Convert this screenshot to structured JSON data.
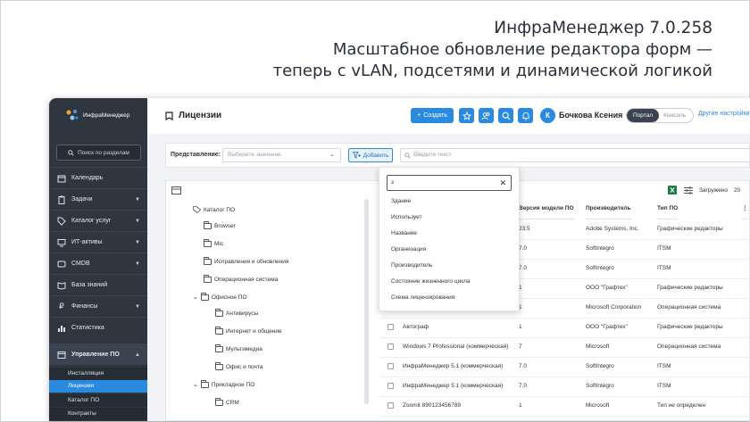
{
  "headline": {
    "line1": "ИнфраМенеджер 7.0.258",
    "line2": "Масштабное обновление редактора форм —",
    "line3": "теперь с vLAN, подсетями и динамической логикой"
  },
  "sidebar": {
    "logo_text": "ИнфраМенеджер",
    "search_placeholder": "Поиск по разделам",
    "items": [
      {
        "label": "Календарь",
        "icon": "calendar-icon"
      },
      {
        "label": "Задачи",
        "icon": "clipboard-icon"
      },
      {
        "label": "Каталог услуг",
        "icon": "tag-icon"
      },
      {
        "label": "ИТ-активы",
        "icon": "monitor-icon"
      },
      {
        "label": "CMDB",
        "icon": "database-icon"
      },
      {
        "label": "База знаний",
        "icon": "book-icon"
      },
      {
        "label": "Финансы",
        "icon": "ruble-icon"
      },
      {
        "label": "Статистика",
        "icon": "bar-chart-icon"
      },
      {
        "label": "Управление ПО",
        "icon": "window-icon"
      }
    ],
    "subitems": [
      "Инсталляции",
      "Лицензии",
      "Каталог ПО",
      "Контракты"
    ]
  },
  "topbar": {
    "title": "Лицензии",
    "create_label": "Создать",
    "avatar_letter": "К",
    "user_name": "Бочкова Ксения",
    "toggle_on": "Портал",
    "toggle_off": "Консоль",
    "other_settings": "Другие настройки"
  },
  "filter": {
    "label": "Представление:",
    "select_placeholder": "Выберите значение",
    "add_label": "Добавить",
    "text_placeholder": "Введите текст"
  },
  "panel": {
    "loaded_label": "Загружено",
    "loaded_count": "20"
  },
  "tree": [
    "Каталог ПО",
    "Browser",
    "Mic",
    "Исправления и обновления",
    "Операционная система",
    "Офисное ПО",
    "Антивирусы",
    "Интернет и общение",
    "Мультимедиа",
    "Офис и почта",
    "Прикладное ПО",
    "CRM"
  ],
  "table": {
    "headers": [
      "Версия модели ПО",
      "Производитель",
      "Тип ПО"
    ],
    "rows": [
      {
        "name": "",
        "version": "23.5",
        "vendor": "Adobe Systems, Inc.",
        "type": "Графические редакторы"
      },
      {
        "name": "",
        "version": "7.0",
        "vendor": "SoftIntegro",
        "type": "ITSM"
      },
      {
        "name": "",
        "version": "7.0",
        "vendor": "SoftIntegro",
        "type": "ITSM"
      },
      {
        "name": "",
        "version": "1",
        "vendor": "ООО \"Графтех\"",
        "type": "Графические редакторы"
      },
      {
        "name": "",
        "version": "1",
        "vendor": "Microsoft Corporation",
        "type": "Операционная система"
      },
      {
        "name": "Автограф",
        "version": "1",
        "vendor": "ООО \"Графтех\"",
        "type": "Графические редакторы"
      },
      {
        "name": "Windows 7 Professional (коммерческая)",
        "version": "7",
        "vendor": "Microsoft",
        "type": "Операционная система"
      },
      {
        "name": "ИнфраМенеджер 5.1 (коммерческая)",
        "version": "7.0",
        "vendor": "SoftIntegro",
        "type": "ITSM"
      },
      {
        "name": "ИнфраМенеджер 5.1 (коммерческая)",
        "version": "7.0",
        "vendor": "SoftIntegro",
        "type": "ITSM"
      },
      {
        "name": "Zoomit 890123456789",
        "version": "1",
        "vendor": "Microsoft",
        "type": "Тип не определен"
      }
    ]
  },
  "dropdown": {
    "query": "з",
    "options": [
      "Здание",
      "Использует",
      "Название",
      "Организация",
      "Производитель",
      "Состояние жизненного цикла",
      "Схема лицензирования"
    ]
  },
  "colors": {
    "accent": "#2a8ae0",
    "sidebar": "#2f3640"
  }
}
